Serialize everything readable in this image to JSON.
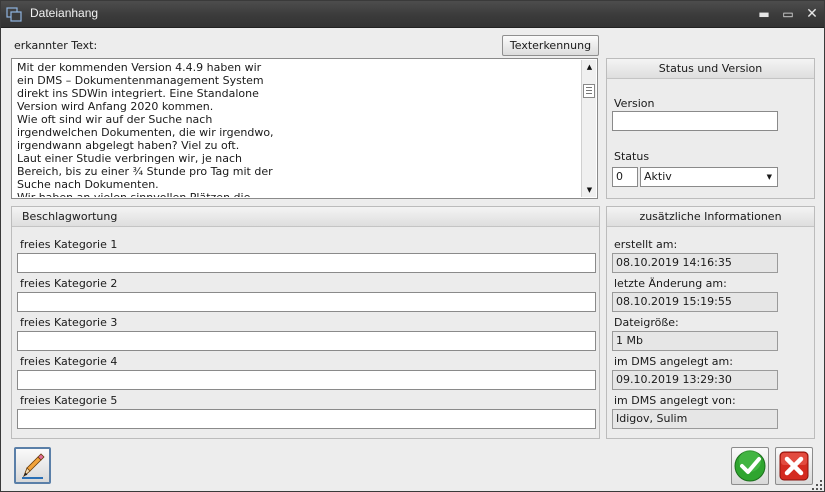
{
  "window": {
    "title": "Dateianhang",
    "controls": {
      "minimize": "▬",
      "maximize": "▭",
      "close": "✕"
    }
  },
  "ocr": {
    "label": "erkannter Text:",
    "button_label": "Texterkennung",
    "text_lines": [
      "Mit der kommenden Version 4.4.9 haben wir",
      "ein DMS – Dokumentenmanagement System",
      "direkt ins SDWin integriert. Eine Standalone",
      "Version wird Anfang 2020 kommen.",
      "Wie oft sind wir auf der Suche nach",
      "irgendwelchen Dokumenten, die wir irgendwo,",
      "irgendwann abgelegt haben? Viel zu oft.",
      "Laut einer Studie verbringen wir, je nach",
      "Bereich, bis zu einer ¾ Stunde pro Tag mit der",
      "Suche nach Dokumenten.",
      "Wir haben an vielen sinnvollen Plätzen die"
    ]
  },
  "status_panel": {
    "title": "Status und Version",
    "version_label": "Version",
    "version_value": "",
    "status_label": "Status",
    "status_code": "0",
    "status_selected": "Aktiv"
  },
  "tagging": {
    "title": "Beschlagwortung",
    "categories": [
      {
        "label": "freies Kategorie 1",
        "value": ""
      },
      {
        "label": "freies Kategorie 2",
        "value": ""
      },
      {
        "label": "freies Kategorie 3",
        "value": ""
      },
      {
        "label": "freies Kategorie 4",
        "value": ""
      },
      {
        "label": "freies Kategorie 5",
        "value": ""
      }
    ]
  },
  "info": {
    "title": "zusätzliche Informationen",
    "created_label": "erstellt am:",
    "created_value": "08.10.2019 14:16:35",
    "modified_label": "letzte Änderung am:",
    "modified_value": "08.10.2019 15:19:55",
    "size_label": "Dateigröße:",
    "size_value": "1 Mb",
    "dms_created_label": "im DMS angelegt am:",
    "dms_created_value": "09.10.2019 13:29:30",
    "dms_by_label": "im DMS angelegt von:",
    "dms_by_value": "Idigov, Sulim"
  },
  "icons": {
    "app": "window-icon",
    "edit": "pencil-icon",
    "ok": "checkmark-icon",
    "cancel": "red-x-icon"
  },
  "colors": {
    "titlebar": "#3b3b3b",
    "ok_green": "#2fa52f",
    "cancel_red": "#d42a1f",
    "edit_border": "#5a7fa8"
  }
}
